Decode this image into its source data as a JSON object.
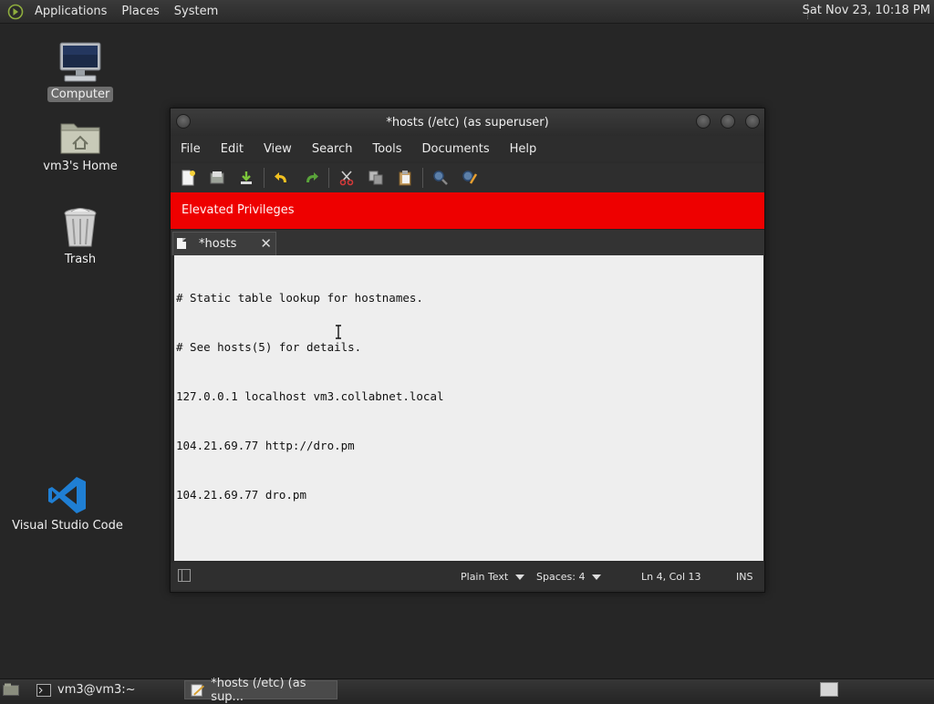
{
  "top_panel": {
    "menus": [
      "Applications",
      "Places",
      "System"
    ],
    "clock": "Sat Nov 23, 10:18 PM"
  },
  "desktop": {
    "icons": [
      {
        "label": "Computer",
        "icon": "computer-icon"
      },
      {
        "label": "vm3's Home",
        "icon": "home-folder-icon"
      },
      {
        "label": "Trash",
        "icon": "trash-icon"
      },
      {
        "label": "Visual Studio Code",
        "icon": "vscode-icon"
      }
    ]
  },
  "window": {
    "title": "*hosts (/etc) (as superuser)",
    "menu": [
      "File",
      "Edit",
      "View",
      "Search",
      "Tools",
      "Documents",
      "Help"
    ],
    "toolbar_icons": [
      "new-document-icon",
      "open-icon",
      "save-icon",
      "undo-icon",
      "redo-icon",
      "cut-icon",
      "copy-icon",
      "paste-icon",
      "find-icon",
      "find-replace-icon"
    ],
    "infobar": "Elevated Privileges",
    "tab": {
      "name": "*hosts"
    },
    "editor_lines": [
      "# Static table lookup for hostnames.",
      "# See hosts(5) for details.",
      "127.0.0.1 localhost vm3.collabnet.local",
      "104.21.69.77 http://dro.pm",
      "104.21.69.77 dro.pm"
    ],
    "status": {
      "language": "Plain Text",
      "spaces": "Spaces: 4",
      "position": "Ln 4, Col 13",
      "mode": "INS"
    }
  },
  "taskbar": {
    "tasks": [
      {
        "label": "vm3@vm3:~",
        "icon": "terminal-icon"
      },
      {
        "label": "*hosts (/etc) (as sup...",
        "icon": "text-editor-icon"
      }
    ]
  },
  "colors": {
    "desktop_bg": "#262626",
    "infobar_bg": "#ee0000",
    "editor_bg": "#eeeeee"
  }
}
